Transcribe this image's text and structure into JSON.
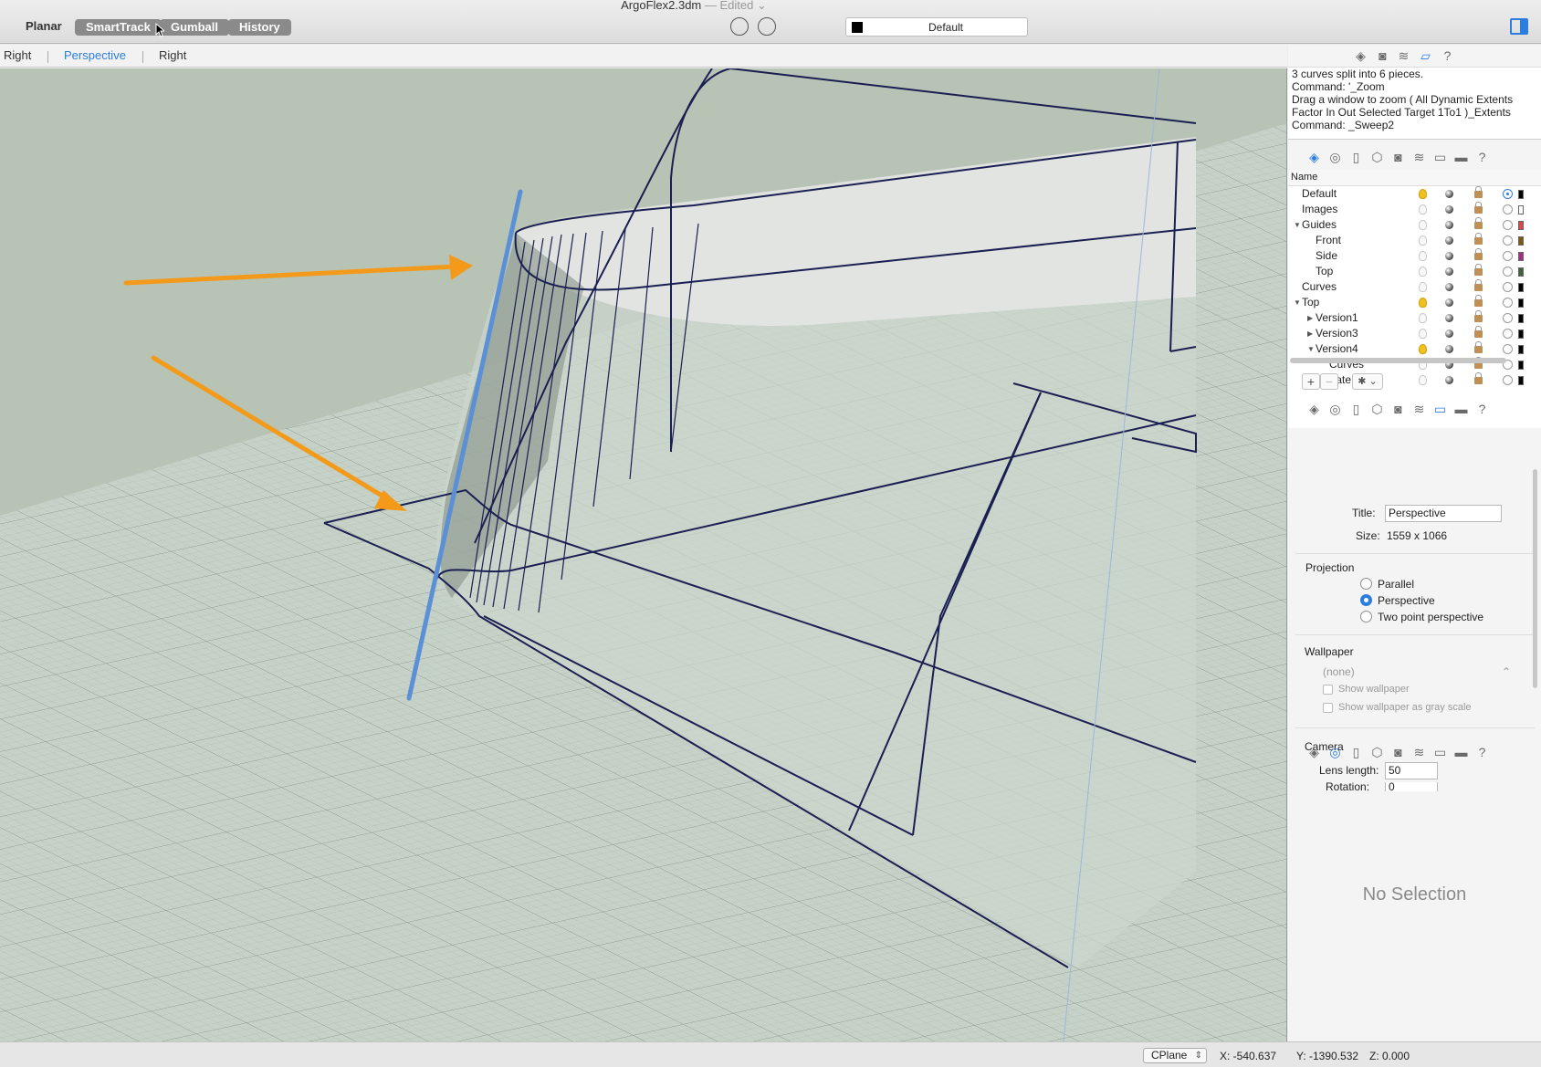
{
  "window": {
    "title": "ArgoFlex2.3dm",
    "title_status": "— Edited ⌄"
  },
  "toolbar": {
    "planar": "Planar",
    "smarttrack": "SmartTrack",
    "gumball": "Gumball",
    "history": "History",
    "current_layer": "Default"
  },
  "viewport_tabs": [
    "Right",
    "Perspective",
    "Right"
  ],
  "command_history": [
    "3 curves split into 6 pieces.",
    "Command: '_Zoom",
    "Drag a window to zoom ( All Dynamic Extents",
    "Factor In Out Selected Target 1To1 )_Extents",
    "Command: _Sweep2"
  ],
  "layers": {
    "header": "Name",
    "items": [
      {
        "name": "Default",
        "depth": 0,
        "toggle": "",
        "light_on": true,
        "current": true,
        "color": "#000000"
      },
      {
        "name": "Images",
        "depth": 0,
        "toggle": "",
        "light_on": false,
        "current": false,
        "color": "#ffffff"
      },
      {
        "name": "Guides",
        "depth": 0,
        "toggle": "▼",
        "light_on": false,
        "current": false,
        "color": "#d84a4a"
      },
      {
        "name": "Front",
        "depth": 1,
        "toggle": "",
        "light_on": false,
        "current": false,
        "color": "#7a5a10"
      },
      {
        "name": "Side",
        "depth": 1,
        "toggle": "",
        "light_on": false,
        "current": false,
        "color": "#a03080"
      },
      {
        "name": "Top",
        "depth": 1,
        "toggle": "",
        "light_on": false,
        "current": false,
        "color": "#406040"
      },
      {
        "name": "Curves",
        "depth": 0,
        "toggle": "",
        "light_on": false,
        "current": false,
        "color": "#000000"
      },
      {
        "name": "Top",
        "depth": 0,
        "toggle": "▼",
        "light_on": true,
        "current": false,
        "color": "#000000"
      },
      {
        "name": "Version1",
        "depth": 1,
        "toggle": "▶",
        "light_on": false,
        "current": false,
        "color": "#000000"
      },
      {
        "name": "Version3",
        "depth": 1,
        "toggle": "▶",
        "light_on": false,
        "current": false,
        "color": "#000000"
      },
      {
        "name": "Version4",
        "depth": 1,
        "toggle": "▼",
        "light_on": true,
        "current": false,
        "color": "#000000"
      },
      {
        "name": "Curves",
        "depth": 2,
        "toggle": "",
        "light_on": false,
        "current": false,
        "color": "#000000"
      },
      {
        "name": "FacePlate",
        "depth": 0,
        "toggle": "",
        "light_on": false,
        "current": false,
        "color": "#000000"
      }
    ],
    "add": "+",
    "remove": "−",
    "gear": "✱ ⌄"
  },
  "viewport_props": {
    "title_label": "Title:",
    "title_value": "Perspective",
    "size_label": "Size:",
    "size_value": "1559 x 1066",
    "projection_heading": "Projection",
    "projection_options": [
      "Parallel",
      "Perspective",
      "Two point perspective"
    ],
    "projection_selected": 1,
    "wallpaper_heading": "Wallpaper",
    "wallpaper_value": "(none)",
    "show_wallpaper": "Show wallpaper",
    "show_gray": "Show wallpaper as gray scale",
    "camera_heading": "Camera",
    "lens_label": "Lens length:",
    "lens_value": "50",
    "rotation_label": "Rotation:",
    "rotation_value": "0"
  },
  "properties": {
    "empty_text": "No Selection"
  },
  "status": {
    "cplane": "CPlane",
    "x": "X: -540.637",
    "y": "Y: -1390.532",
    "z": "Z: 0.000"
  },
  "colors": {
    "accent": "#2b7de0",
    "viewport_background": "#b7c3b5",
    "grid_plane": "#c5d1c6",
    "curve": "#1a1f52",
    "annotation_arrow": "#f39a1a",
    "annotation_line": "#5b8fd6"
  },
  "icons": {
    "panel_tabs": [
      "layers-icon",
      "camera-icon",
      "render-icon",
      "properties-icon",
      "help-icon"
    ],
    "panel_tabs_full": [
      "layers-icon",
      "materials-icon",
      "document-icon",
      "object-icon",
      "camera-icon",
      "render-icon",
      "viewport-icon",
      "display-icon",
      "help-icon"
    ]
  }
}
